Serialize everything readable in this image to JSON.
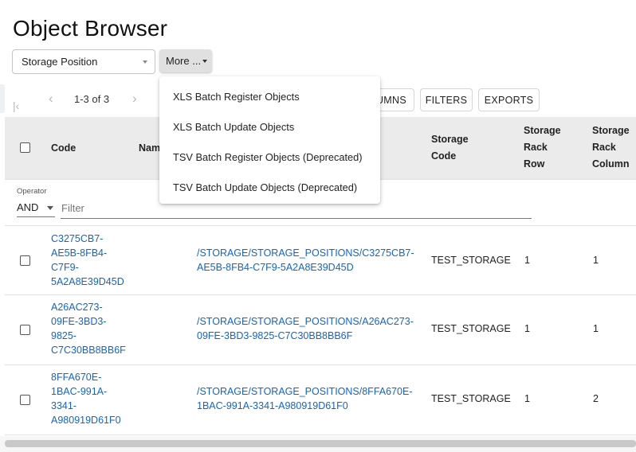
{
  "page": {
    "title": "Object Browser"
  },
  "toolbar": {
    "type_select_value": "Storage Position",
    "more_label": "More ..."
  },
  "menu": {
    "items": [
      "XLS Batch Register Objects",
      "XLS Batch Update Objects",
      "TSV Batch Register Objects (Deprecated)",
      "TSV Batch Update Objects (Deprecated)"
    ]
  },
  "pager": {
    "range": "1-3 of 3"
  },
  "grid_buttons": {
    "columns": "UMNS",
    "filters": "FILTERS",
    "exports": "EXPORTS"
  },
  "table": {
    "headers": {
      "code": "Code",
      "name": "Nam",
      "storage_code_1": "Storage",
      "storage_code_2": "Code",
      "rack_row_1": "Storage",
      "rack_row_2": "Rack",
      "rack_row_3": "Row",
      "rack_col_1": "Storage",
      "rack_col_2": "Rack",
      "rack_col_3": "Column"
    },
    "filter": {
      "operator_label": "Operator",
      "operator_value": "AND",
      "placeholder": "Filter"
    },
    "rows": [
      {
        "code_lines": [
          "C3275CB7-",
          "AE5B-8FB4-",
          "C7F9-",
          "5A2A8E39D45D"
        ],
        "path_lines": [
          "/STORAGE/STORAGE_POSITIONS/C3275CB7-",
          "AE5B-8FB4-C7F9-5A2A8E39D45D"
        ],
        "storage_code": "TEST_STORAGE",
        "rack_row": "1",
        "rack_column": "1"
      },
      {
        "code_lines": [
          "A26AC273-",
          "09FE-3BD3-",
          "9825-",
          "C7C30BB8BB6F"
        ],
        "path_lines": [
          "/STORAGE/STORAGE_POSITIONS/A26AC273-",
          "09FE-3BD3-9825-C7C30BB8BB6F"
        ],
        "storage_code": "TEST_STORAGE",
        "rack_row": "1",
        "rack_column": "1"
      },
      {
        "code_lines": [
          "8FFA670E-",
          "1BAC-991A-",
          "3341-",
          "A980919D61F0"
        ],
        "path_lines": [
          "/STORAGE/STORAGE_POSITIONS/8FFA670E-",
          "1BAC-991A-3341-A980919D61F0"
        ],
        "storage_code": "TEST_STORAGE",
        "rack_row": "1",
        "rack_column": "2"
      }
    ]
  },
  "colors": {
    "link": "#1565c0",
    "header_bg": "#ebebeb",
    "button_bg": "#e0e0e0"
  }
}
